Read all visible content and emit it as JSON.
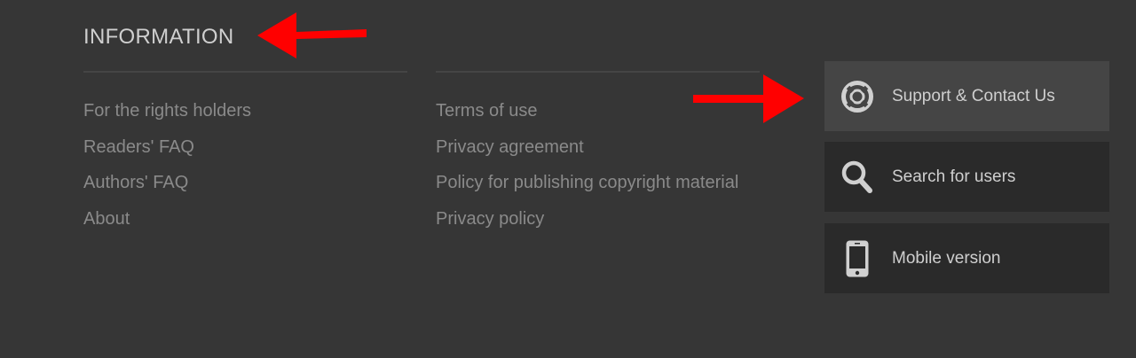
{
  "section": {
    "title": "INFORMATION"
  },
  "links_left": [
    "For the rights holders",
    "Readers' FAQ",
    "Authors' FAQ",
    "About"
  ],
  "links_right": [
    "Terms of use",
    "Privacy agreement",
    "Policy for publishing copyright material",
    "Privacy policy"
  ],
  "tiles": [
    {
      "label": "Support & Contact Us",
      "icon": "lifebuoy-icon"
    },
    {
      "label": "Search for users",
      "icon": "search-icon"
    },
    {
      "label": "Mobile version",
      "icon": "smartphone-icon"
    }
  ],
  "colors": {
    "background": "#363636",
    "tile": "#2a2a2a",
    "tile_active": "#454545",
    "link": "#8a8a8a",
    "heading": "#cfcfcf",
    "annotation_arrow": "#ff0000"
  }
}
